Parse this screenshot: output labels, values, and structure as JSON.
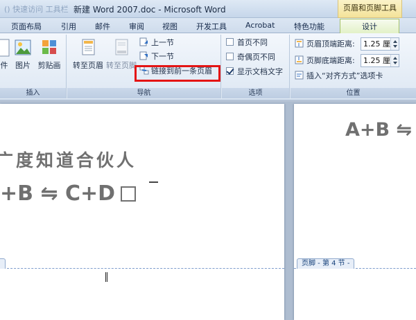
{
  "titlebar": {
    "title": "新建 Word 2007.doc - Microsoft Word",
    "ghost": "() 快速访问 工具栏",
    "context_tool": "页眉和页脚工具"
  },
  "tabs": [
    {
      "label": "页面布局"
    },
    {
      "label": "引用"
    },
    {
      "label": "邮件"
    },
    {
      "label": "审阅"
    },
    {
      "label": "视图"
    },
    {
      "label": "开发工具"
    },
    {
      "label": "Acrobat"
    },
    {
      "label": "特色功能"
    },
    {
      "label": "设计",
      "active": true
    }
  ],
  "ribbon": {
    "insert_group": {
      "label": "插入",
      "buttons": [
        "件",
        "图片",
        "剪贴画"
      ]
    },
    "nav_group": {
      "label": "导航",
      "goto_header": "转至页眉",
      "goto_footer": "转至页脚",
      "prev_section": "上一节",
      "next_section": "下一节",
      "link_previous": "链接到前一条页眉"
    },
    "options_group": {
      "label": "选项",
      "first_page_diff": {
        "label": "首页不同",
        "checked": false
      },
      "odd_even_diff": {
        "label": "奇偶页不同",
        "checked": false
      },
      "show_doc_text": {
        "label": "显示文档文字",
        "checked": true
      }
    },
    "position_group": {
      "label": "位置",
      "header_top_label": "页眉顶端距离:",
      "header_top_value": "1.25 厘米",
      "footer_bottom_label": "页脚底端距离:",
      "footer_bottom_value": "1.25 厘米",
      "insert_tab_align": "插入“对齐方式”选项卡"
    }
  },
  "document": {
    "page1_line1": "广度知道合伙人",
    "page1_line2": "+B ⇋ C+D",
    "page2_line1": "A+B ⇋",
    "page2_footer_tag": "页脚 - 第 4 节 -"
  },
  "colors": {
    "highlight": "#e41414",
    "design_tab": "#e3f1c7",
    "context_tool": "#f4e39a"
  }
}
